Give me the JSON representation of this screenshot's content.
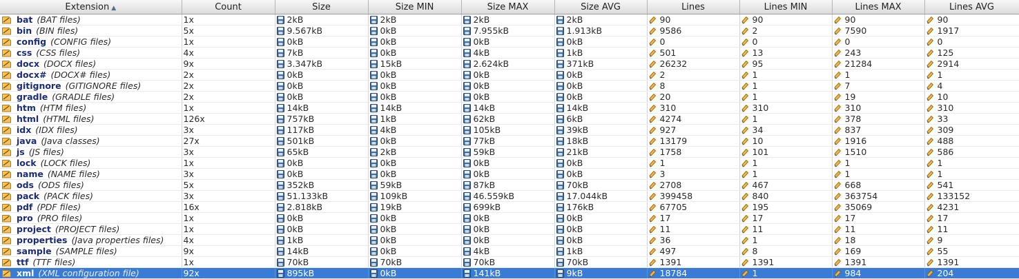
{
  "columns": {
    "extension": "Extension",
    "count": "Count",
    "size": "Size",
    "size_min": "Size MIN",
    "size_max": "Size MAX",
    "size_avg": "Size AVG",
    "lines": "Lines",
    "lines_min": "Lines MIN",
    "lines_max": "Lines MAX",
    "lines_avg": "Lines AVG"
  },
  "sort": {
    "column": "extension",
    "direction": "ascending",
    "indicator": "▲"
  },
  "colors": {
    "selection": "#3a7bd5",
    "extension_name": "#1b2a7a",
    "header_bg": "#e6e6e6"
  },
  "icons": {
    "extension": "folder-tag-icon",
    "size": "floppy-disk-icon",
    "lines": "pencil-icon"
  },
  "selected_row": 23,
  "rows": [
    {
      "ext": "bat",
      "desc": "(BAT files)",
      "count": "1x",
      "size": "2kB",
      "size_min": "2kB",
      "size_max": "2kB",
      "size_avg": "2kB",
      "lines": "90",
      "lines_min": "90",
      "lines_max": "90",
      "lines_avg": "90"
    },
    {
      "ext": "bin",
      "desc": "(BIN files)",
      "count": "5x",
      "size": "9.567kB",
      "size_min": "0kB",
      "size_max": "7.955kB",
      "size_avg": "1.913kB",
      "lines": "9586",
      "lines_min": "2",
      "lines_max": "7590",
      "lines_avg": "1917"
    },
    {
      "ext": "config",
      "desc": "(CONFIG files)",
      "count": "1x",
      "size": "0kB",
      "size_min": "0kB",
      "size_max": "0kB",
      "size_avg": "0kB",
      "lines": "0",
      "lines_min": "0",
      "lines_max": "0",
      "lines_avg": "0"
    },
    {
      "ext": "css",
      "desc": "(CSS files)",
      "count": "4x",
      "size": "7kB",
      "size_min": "0kB",
      "size_max": "4kB",
      "size_avg": "1kB",
      "lines": "501",
      "lines_min": "13",
      "lines_max": "243",
      "lines_avg": "125"
    },
    {
      "ext": "docx",
      "desc": "(DOCX files)",
      "count": "9x",
      "size": "3.347kB",
      "size_min": "15kB",
      "size_max": "2.624kB",
      "size_avg": "371kB",
      "lines": "26232",
      "lines_min": "95",
      "lines_max": "21284",
      "lines_avg": "2914"
    },
    {
      "ext": "docx#",
      "desc": "(DOCX# files)",
      "count": "2x",
      "size": "0kB",
      "size_min": "0kB",
      "size_max": "0kB",
      "size_avg": "0kB",
      "lines": "2",
      "lines_min": "1",
      "lines_max": "1",
      "lines_avg": "1"
    },
    {
      "ext": "gitignore",
      "desc": "(GITIGNORE files)",
      "count": "2x",
      "size": "0kB",
      "size_min": "0kB",
      "size_max": "0kB",
      "size_avg": "0kB",
      "lines": "8",
      "lines_min": "1",
      "lines_max": "7",
      "lines_avg": "4"
    },
    {
      "ext": "gradle",
      "desc": "(GRADLE files)",
      "count": "2x",
      "size": "0kB",
      "size_min": "0kB",
      "size_max": "0kB",
      "size_avg": "0kB",
      "lines": "20",
      "lines_min": "1",
      "lines_max": "19",
      "lines_avg": "10"
    },
    {
      "ext": "htm",
      "desc": "(HTM files)",
      "count": "1x",
      "size": "14kB",
      "size_min": "14kB",
      "size_max": "14kB",
      "size_avg": "14kB",
      "lines": "310",
      "lines_min": "310",
      "lines_max": "310",
      "lines_avg": "310"
    },
    {
      "ext": "html",
      "desc": "(HTML files)",
      "count": "126x",
      "size": "757kB",
      "size_min": "1kB",
      "size_max": "62kB",
      "size_avg": "6kB",
      "lines": "4274",
      "lines_min": "1",
      "lines_max": "378",
      "lines_avg": "33"
    },
    {
      "ext": "idx",
      "desc": "(IDX files)",
      "count": "3x",
      "size": "117kB",
      "size_min": "4kB",
      "size_max": "105kB",
      "size_avg": "39kB",
      "lines": "927",
      "lines_min": "34",
      "lines_max": "837",
      "lines_avg": "309"
    },
    {
      "ext": "java",
      "desc": "(Java classes)",
      "count": "27x",
      "size": "501kB",
      "size_min": "0kB",
      "size_max": "77kB",
      "size_avg": "18kB",
      "lines": "13179",
      "lines_min": "10",
      "lines_max": "1916",
      "lines_avg": "488"
    },
    {
      "ext": "js",
      "desc": "(JS files)",
      "count": "3x",
      "size": "65kB",
      "size_min": "2kB",
      "size_max": "59kB",
      "size_avg": "21kB",
      "lines": "1758",
      "lines_min": "101",
      "lines_max": "1510",
      "lines_avg": "586"
    },
    {
      "ext": "lock",
      "desc": "(LOCK files)",
      "count": "1x",
      "size": "0kB",
      "size_min": "0kB",
      "size_max": "0kB",
      "size_avg": "0kB",
      "lines": "1",
      "lines_min": "1",
      "lines_max": "1",
      "lines_avg": "1"
    },
    {
      "ext": "name",
      "desc": "(NAME files)",
      "count": "3x",
      "size": "0kB",
      "size_min": "0kB",
      "size_max": "0kB",
      "size_avg": "0kB",
      "lines": "3",
      "lines_min": "1",
      "lines_max": "1",
      "lines_avg": "1"
    },
    {
      "ext": "ods",
      "desc": "(ODS files)",
      "count": "5x",
      "size": "352kB",
      "size_min": "59kB",
      "size_max": "87kB",
      "size_avg": "70kB",
      "lines": "2708",
      "lines_min": "467",
      "lines_max": "668",
      "lines_avg": "541"
    },
    {
      "ext": "pack",
      "desc": "(PACK files)",
      "count": "3x",
      "size": "51.133kB",
      "size_min": "109kB",
      "size_max": "46.559kB",
      "size_avg": "17.044kB",
      "lines": "399458",
      "lines_min": "840",
      "lines_max": "363754",
      "lines_avg": "133152"
    },
    {
      "ext": "pdf",
      "desc": "(PDF files)",
      "count": "16x",
      "size": "2.818kB",
      "size_min": "19kB",
      "size_max": "699kB",
      "size_avg": "176kB",
      "lines": "67705",
      "lines_min": "195",
      "lines_max": "35069",
      "lines_avg": "4231"
    },
    {
      "ext": "pro",
      "desc": "(PRO files)",
      "count": "1x",
      "size": "0kB",
      "size_min": "0kB",
      "size_max": "0kB",
      "size_avg": "0kB",
      "lines": "17",
      "lines_min": "17",
      "lines_max": "17",
      "lines_avg": "17"
    },
    {
      "ext": "project",
      "desc": "(PROJECT files)",
      "count": "1x",
      "size": "0kB",
      "size_min": "0kB",
      "size_max": "0kB",
      "size_avg": "0kB",
      "lines": "11",
      "lines_min": "11",
      "lines_max": "11",
      "lines_avg": "11"
    },
    {
      "ext": "properties",
      "desc": "(Java properties files)",
      "count": "4x",
      "size": "1kB",
      "size_min": "0kB",
      "size_max": "0kB",
      "size_avg": "0kB",
      "lines": "36",
      "lines_min": "1",
      "lines_max": "18",
      "lines_avg": "9"
    },
    {
      "ext": "sample",
      "desc": "(SAMPLE files)",
      "count": "9x",
      "size": "14kB",
      "size_min": "0kB",
      "size_max": "4kB",
      "size_avg": "1kB",
      "lines": "497",
      "lines_min": "8",
      "lines_max": "169",
      "lines_avg": "55"
    },
    {
      "ext": "ttf",
      "desc": "(TTF files)",
      "count": "1x",
      "size": "70kB",
      "size_min": "70kB",
      "size_max": "70kB",
      "size_avg": "70kB",
      "lines": "1391",
      "lines_min": "1391",
      "lines_max": "1391",
      "lines_avg": "1391"
    },
    {
      "ext": "xml",
      "desc": "(XML configuration file)",
      "count": "92x",
      "size": "895kB",
      "size_min": "0kB",
      "size_max": "141kB",
      "size_avg": "9kB",
      "lines": "18784",
      "lines_min": "1",
      "lines_max": "984",
      "lines_avg": "204"
    }
  ]
}
